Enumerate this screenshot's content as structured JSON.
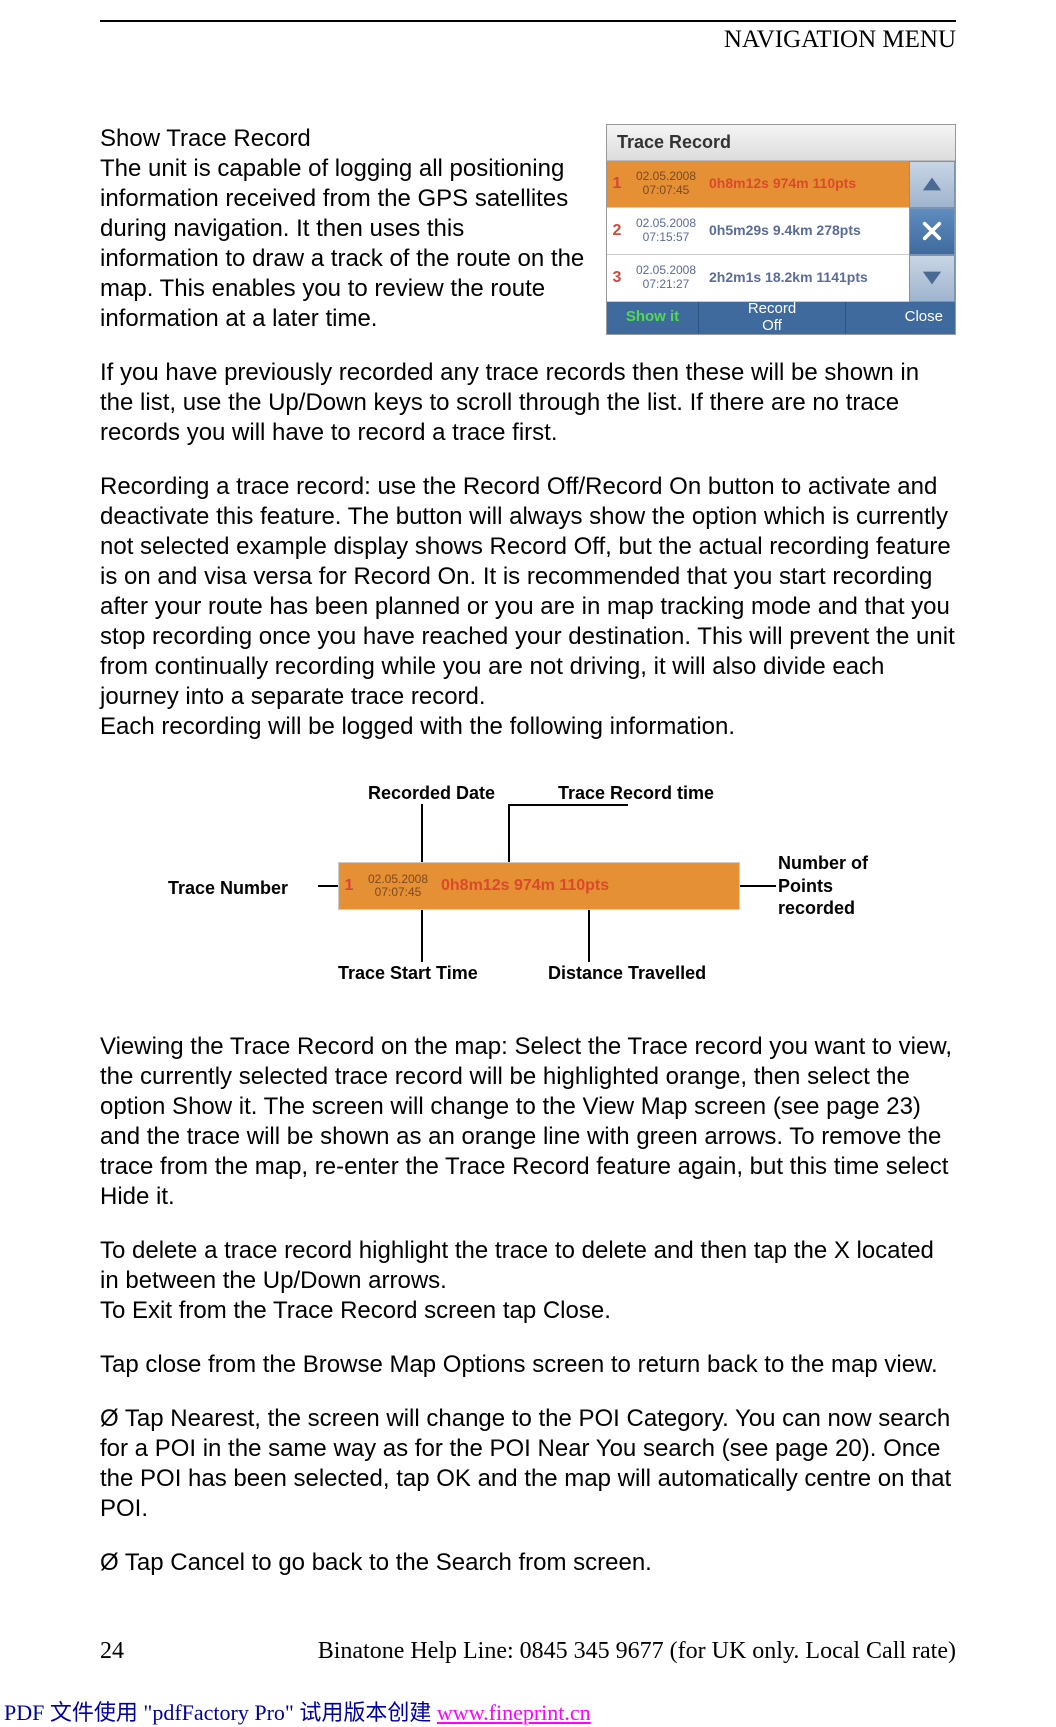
{
  "header": {
    "title": "NAVIGATION MENU"
  },
  "content": {
    "section_title": "Show Trace Record",
    "para1": "The unit is capable of logging all positioning information received from the GPS satellites during navigation. It then uses this information to draw a track of the route on the map. This enables you to review the route information at a later time.",
    "para2": "If you have previously recorded any trace records then these will be shown in the list, use the Up/Down keys to scroll through the list. If there are no trace records you will have to record a trace first.",
    "para3": "Recording a trace record: use the Record Off/Record On button to activate and deactivate this feature. The button will always show the option which is currently not selected example display shows Record Off, but the actual recording feature is on and visa versa for Record On. It is recommended that you start recording after your route has been planned or you are in map tracking mode and that you stop recording once you have reached your destination. This will prevent the unit from continually recording while you are not driving, it will also divide each journey into a separate trace record.",
    "para3b": "Each recording will be logged with the following information.",
    "para4": "Viewing the Trace Record on the map: Select the Trace record you want to view, the currently selected trace record will be highlighted orange, then select the option Show it. The screen will change to the View Map screen (see page 23) and the trace will be shown as an orange line with green arrows. To remove the trace from the map, re-enter the Trace Record feature again, but this time select Hide it.",
    "para5": "To delete a trace record highlight the trace to delete and then tap the X located in between the Up/Down arrows.",
    "para5b": "To Exit from the Trace Record screen tap Close.",
    "para6": "Tap close from the Browse Map Options screen to return back to the map view.",
    "para7": "Ø Tap Nearest, the screen will change to the POI Category. You can now search for a POI in the same way as for the POI Near You search (see page 20). Once the POI has been selected, tap OK and the map will automatically centre on that POI.",
    "para8": "Ø Tap Cancel to go back to the Search from screen."
  },
  "trace_widget": {
    "title": "Trace Record",
    "rows": [
      {
        "num": "1",
        "date": "02.05.2008",
        "time": "07:07:45",
        "info": "0h8m12s 974m 110pts",
        "selected": true
      },
      {
        "num": "2",
        "date": "02.05.2008",
        "time": "07:15:57",
        "info": "0h5m29s 9.4km 278pts",
        "selected": false
      },
      {
        "num": "3",
        "date": "02.05.2008",
        "time": "07:21:27",
        "info": "2h2m1s 18.2km 1141pts",
        "selected": false
      }
    ],
    "buttons": {
      "showit": "Show it",
      "record": "Record\nOff",
      "close": "Close"
    }
  },
  "anno": {
    "labels": {
      "trace_number": "Trace Number",
      "recorded_date": "Recorded Date",
      "trace_record_time": "Trace Record time",
      "number_points": "Number of\nPoints recorded",
      "trace_start_time": "Trace Start Time",
      "distance_travelled": "Distance Travelled"
    },
    "row": {
      "num": "1",
      "date": "02.05.2008",
      "time": "07:07:45",
      "info": "0h8m12s 974m 110pts"
    }
  },
  "footer": {
    "page_num": "24",
    "helpline": "Binatone Help Line: 0845 345 9677 (for UK only. Local Call rate)"
  },
  "pdf_footer": {
    "prefix": "PDF 文件使用 \"pdfFactory Pro\" 试用版本创建 ",
    "link_text": "www.fineprint.cn"
  }
}
